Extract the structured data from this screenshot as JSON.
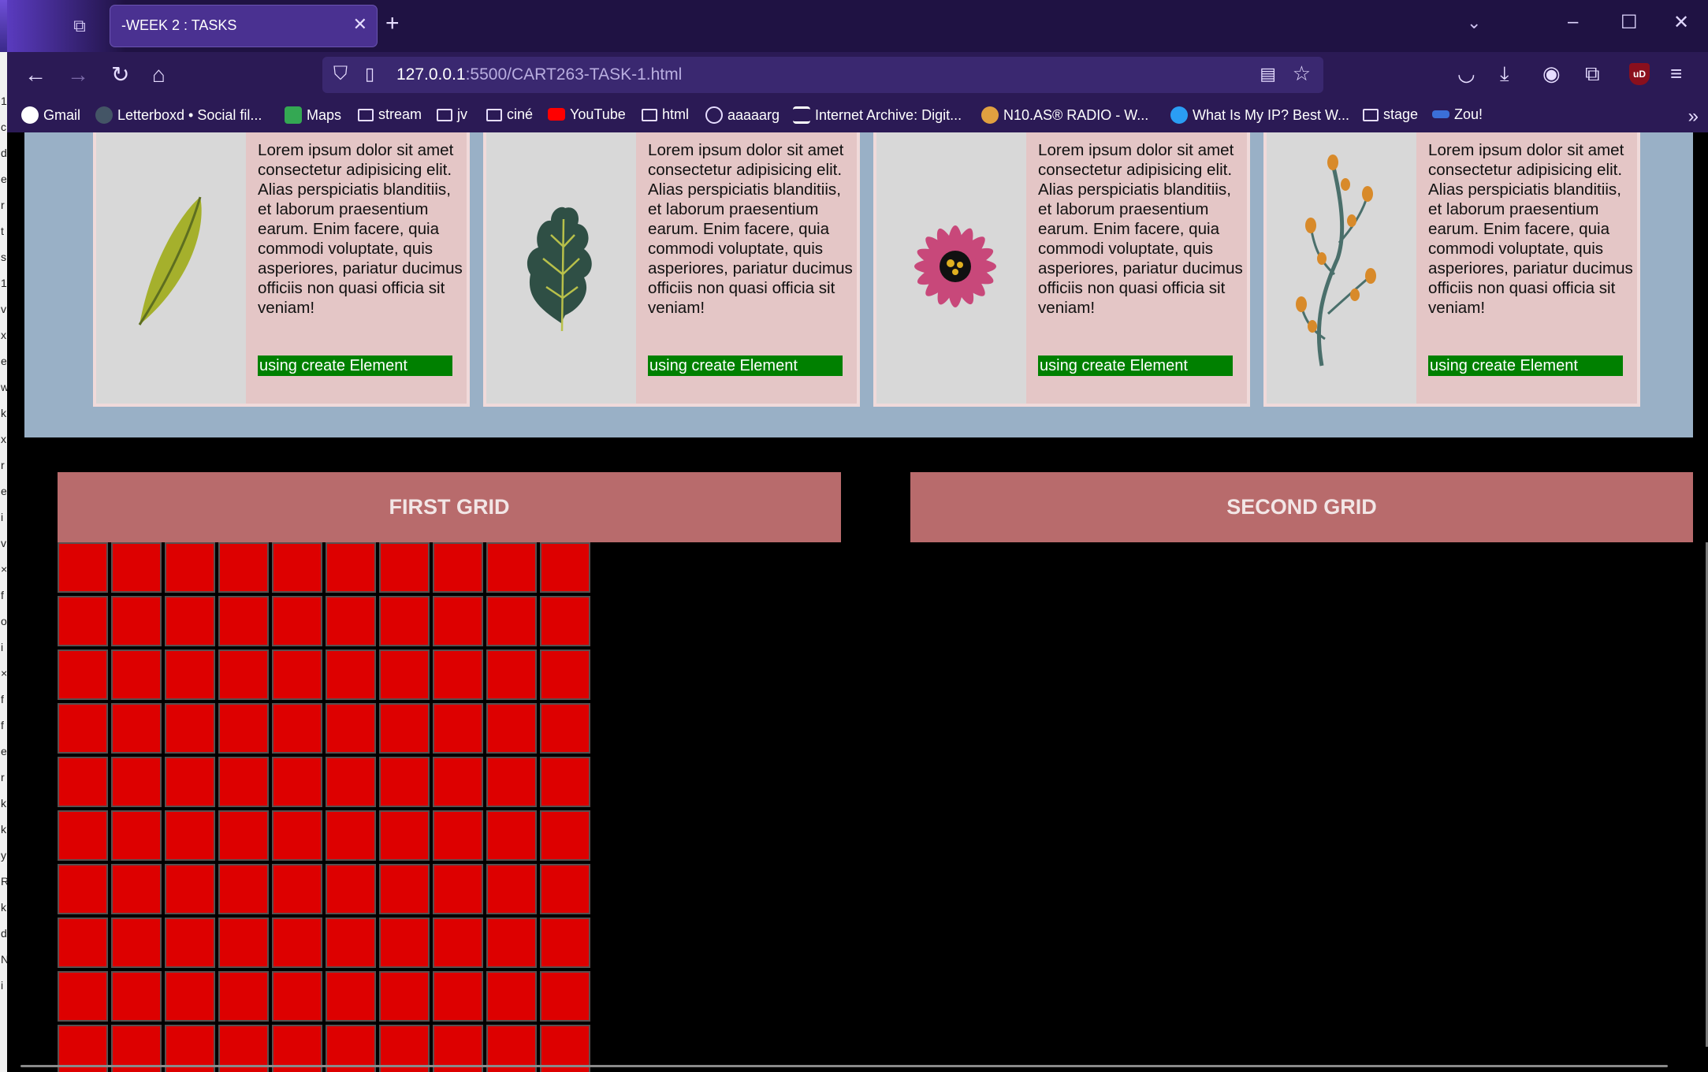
{
  "browser": {
    "tab_title": "-WEEK 2 : TASKS",
    "url_host": "127.0.0.1",
    "url_path": ":5500/CART263-TASK-1.html",
    "bookmarks": [
      "Gmail",
      "Letterboxd • Social fil...",
      "Maps",
      "stream",
      "jv",
      "ciné",
      "YouTube",
      "html",
      "aaaaarg",
      "Internet Archive: Digit...",
      "N10.AS® RADIO - W...",
      "What Is My IP? Best W...",
      "stage",
      "Zou!"
    ],
    "ublock_label": "uD"
  },
  "cards": [
    {
      "text": "Lorem ipsum dolor sit amet consectetur adipisicing elit. Alias perspiciatis blanditiis, et laborum praesentium earum. Enim facere, quia commodi voluptate, quis asperiores, pariatur ducimus officiis non quasi officia sit veniam!",
      "button": "using create Element",
      "image": "leaf-illustration"
    },
    {
      "text": "Lorem ipsum dolor sit amet consectetur adipisicing elit. Alias perspiciatis blanditiis, et laborum praesentium earum. Enim facere, quia commodi voluptate, quis asperiores, pariatur ducimus officiis non quasi officia sit veniam!",
      "button": "using create Element",
      "image": "oak-leaf-illustration"
    },
    {
      "text": "Lorem ipsum dolor sit amet consectetur adipisicing elit. Alias perspiciatis blanditiis, et laborum praesentium earum. Enim facere, quia commodi voluptate, quis asperiores, pariatur ducimus officiis non quasi officia sit veniam!",
      "button": "using create Element",
      "image": "pink-flower-illustration"
    },
    {
      "text": "Lorem ipsum dolor sit amet consectetur adipisicing elit. Alias perspiciatis blanditiis, et laborum praesentium earum. Enim facere, quia commodi voluptate, quis asperiores, pariatur ducimus officiis non quasi officia sit veniam!",
      "button": "using create Element",
      "image": "berry-branch-illustration"
    }
  ],
  "grids": {
    "first_label": "FIRST GRID",
    "second_label": "SECOND GRID",
    "visible_cell_rows": 10,
    "visible_cell_cols": 10
  },
  "colors": {
    "cell": "#dd0000",
    "header": "#b86b6c",
    "band": "#99b0c6",
    "button": "#008000"
  }
}
